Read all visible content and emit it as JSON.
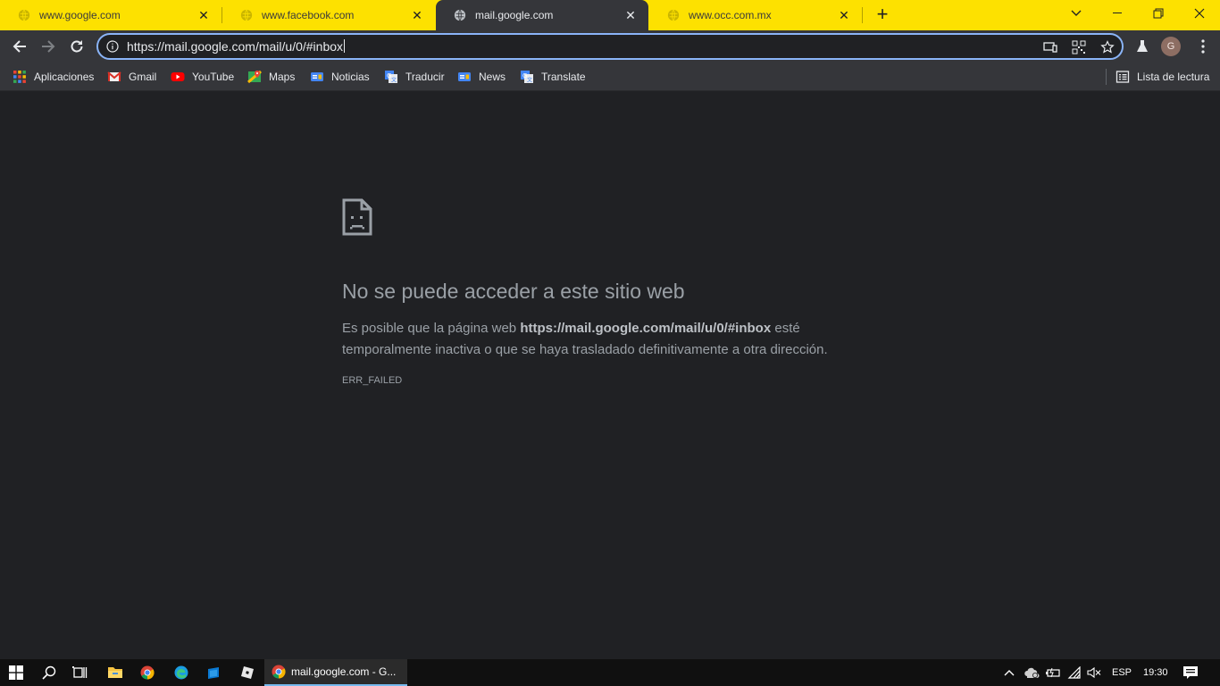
{
  "tabs": [
    {
      "title": "www.google.com",
      "active": false
    },
    {
      "title": "www.facebook.com",
      "active": false
    },
    {
      "title": "mail.google.com",
      "active": true
    },
    {
      "title": "www.occ.com.mx",
      "active": false
    }
  ],
  "address_bar": {
    "url": "https://mail.google.com/mail/u/0/#inbox"
  },
  "profile": {
    "initial": "G"
  },
  "bookmarks": [
    {
      "label": "Aplicaciones",
      "icon": "apps-grid-icon"
    },
    {
      "label": "Gmail",
      "icon": "gmail-icon"
    },
    {
      "label": "YouTube",
      "icon": "youtube-icon"
    },
    {
      "label": "Maps",
      "icon": "maps-icon"
    },
    {
      "label": "Noticias",
      "icon": "news-icon"
    },
    {
      "label": "Traducir",
      "icon": "translate-icon"
    },
    {
      "label": "News",
      "icon": "news-icon"
    },
    {
      "label": "Translate",
      "icon": "translate-icon"
    }
  ],
  "reading_list": {
    "label": "Lista de lectura"
  },
  "error": {
    "title": "No se puede acceder a este sitio web",
    "desc_prefix": "Es posible que la página web ",
    "desc_url": "https://mail.google.com/mail/u/0/#inbox",
    "desc_suffix": " esté temporalmente inactiva o que se haya trasladado definitivamente a otra dirección.",
    "code": "ERR_FAILED"
  },
  "taskbar": {
    "active_app": "mail.google.com - G...",
    "language": "ESP",
    "time": "19:30"
  },
  "colors": {
    "tabstrip": "#fde100",
    "toolbar": "#35363a",
    "content_bg": "#202124",
    "focus_ring": "#8ab4f8"
  }
}
